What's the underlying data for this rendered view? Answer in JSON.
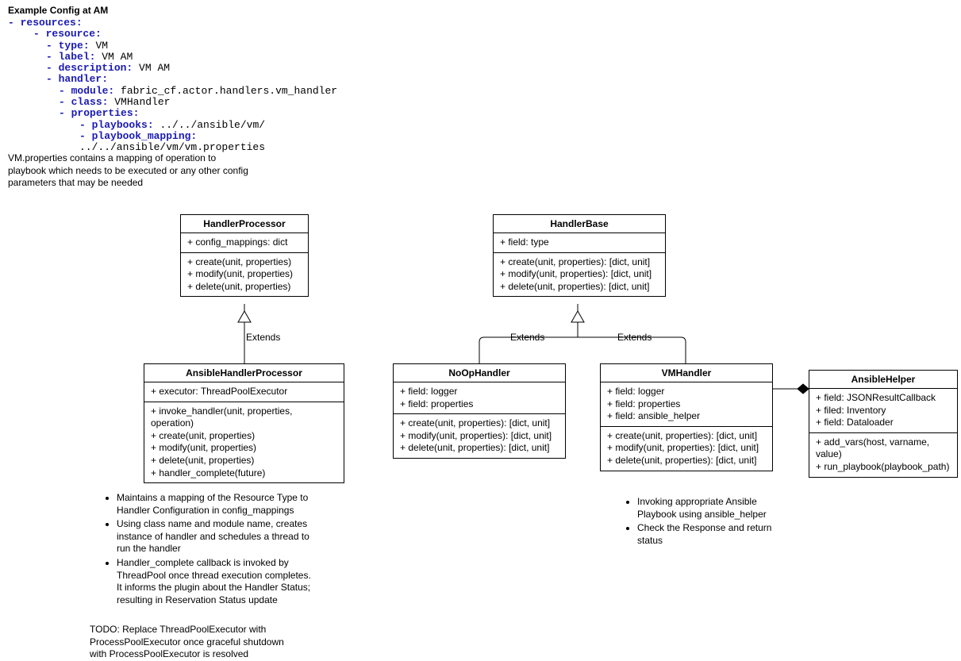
{
  "heading": "Example Config at AM",
  "yaml": {
    "resources": "resources:",
    "resource": "resource:",
    "type_k": "type:",
    "type_v": "VM",
    "label_k": "label:",
    "label_v": "VM AM",
    "desc_k": "description:",
    "desc_v": "VM AM",
    "handler": "handler:",
    "module_k": "module:",
    "module_v": "fabric_cf.actor.handlers.vm_handler",
    "class_k": "class:",
    "class_v": "VMHandler",
    "properties": "properties:",
    "pb_k": "playbooks:",
    "pb_v": "../../ansible/vm/",
    "pbm_k": "playbook_mapping:",
    "pbm_v": "../../ansible/vm/vm.properties"
  },
  "note1_l1": "VM.properties contains a mapping of operation to",
  "note1_l2": "playbook which needs to be executed or any other config",
  "note1_l3": "parameters that may be needed",
  "hp": {
    "title": "HandlerProcessor",
    "f1": "+ config_mappings: dict",
    "m1": "+ create(unit, properties)",
    "m2": "+ modify(unit, properties)",
    "m3": "+ delete(unit, properties)"
  },
  "ahp": {
    "title": "AnsibleHandlerProcessor",
    "f1": "+ executor: ThreadPoolExecutor",
    "m1": "+ invoke_handler(unit, properties, operation)",
    "m2": "+ create(unit, properties)",
    "m3": "+ modify(unit, properties)",
    "m4": "+ delete(unit, properties)",
    "m5": "+ handler_complete(future)"
  },
  "hb": {
    "title": "HandlerBase",
    "f1": "+ field: type",
    "m1": "+ create(unit, properties): [dict,  unit]",
    "m2": "+ modify(unit, properties): [dict,  unit]",
    "m3": "+ delete(unit, properties): [dict,  unit]"
  },
  "noop": {
    "title": "NoOpHandler",
    "f1": "+ field: logger",
    "f2": "+ field: properties",
    "m1": "+ create(unit, properties): [dict,  unit]",
    "m2": "+ modify(unit, properties): [dict,  unit]",
    "m3": "+ delete(unit, properties): [dict,  unit]"
  },
  "vmh": {
    "title": "VMHandler",
    "f1": "+ field: logger",
    "f2": "+ field: properties",
    "f3": "+ field: ansible_helper",
    "m1": "+ create(unit, properties): [dict,  unit]",
    "m2": "+ modify(unit, properties): [dict,  unit]",
    "m3": "+ delete(unit, properties): [dict,  unit]"
  },
  "ah": {
    "title": "AnsibleHelper",
    "f1": "+ field: JSONResultCallback",
    "f2": "+ filed: Inventory",
    "f3": "+ field: Dataloader",
    "m1": "+ add_vars(host, varname, value)",
    "m2": "+ run_playbook(playbook_path)"
  },
  "extends": "Extends",
  "bl": {
    "i1": "Maintains a mapping of the Resource Type to Handler Configuration in config_mappings",
    "i2": "Using class name and module name, creates instance of handler and schedules a thread to run the handler",
    "i3": "Handler_complete callback is invoked by ThreadPool once thread execution completes. It informs the plugin about the Handler Status; resulting in Reservation Status update"
  },
  "todo_l1": "TODO: Replace ThreadPoolExecutor with",
  "todo_l2": "ProcessPoolExecutor once graceful shutdown",
  "todo_l3": "with ProcessPoolExecutor is resolved",
  "br": {
    "i1": "Invoking appropriate Ansible Playbook using ansible_helper",
    "i2": "Check the Response and return status"
  }
}
